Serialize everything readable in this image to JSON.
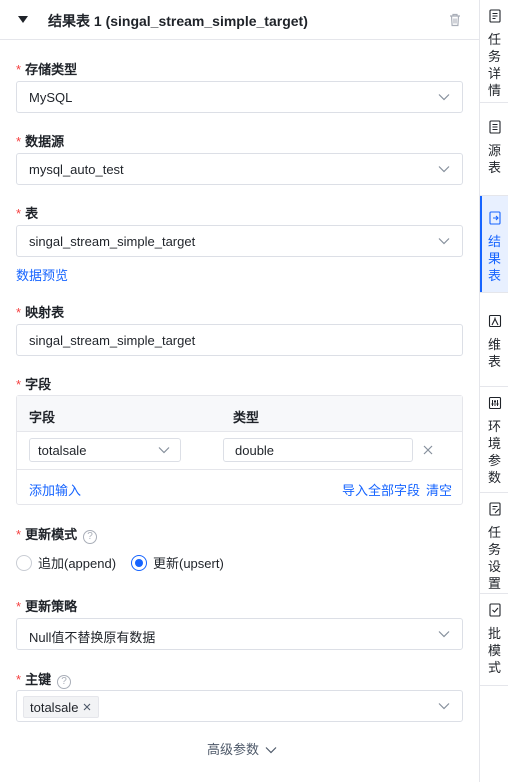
{
  "header": {
    "title": "结果表 1 (singal_stream_simple_target)"
  },
  "form": {
    "storage_type": {
      "label": "存储类型",
      "value": "MySQL"
    },
    "datasource": {
      "label": "数据源",
      "value": "mysql_auto_test"
    },
    "table": {
      "label": "表",
      "value": "singal_stream_simple_target",
      "preview_link": "数据预览"
    },
    "mapping_table": {
      "label": "映射表",
      "value": "singal_stream_simple_target"
    },
    "fields": {
      "label": "字段",
      "col_field": "字段",
      "col_type": "类型",
      "rows": [
        {
          "field": "totalsale",
          "type": "double"
        }
      ],
      "add_input": "添加输入",
      "import_all": "导入全部字段",
      "clear": "清空"
    },
    "update_mode": {
      "label": "更新模式",
      "help": "?",
      "options": [
        {
          "label": "追加(append)",
          "selected": false
        },
        {
          "label": "更新(upsert)",
          "selected": true
        }
      ]
    },
    "update_strategy": {
      "label": "更新策略",
      "value": "Null值不替换原有数据"
    },
    "primary_key": {
      "label": "主键",
      "help": "?",
      "tags": [
        "totalsale"
      ]
    },
    "advanced": "高级参数"
  },
  "sidebar": {
    "items": [
      {
        "label": "任务详情",
        "icon": "document-list-icon",
        "active": false
      },
      {
        "label": "源表",
        "icon": "source-table-icon",
        "active": false
      },
      {
        "label": "结果表",
        "icon": "result-table-icon",
        "active": true
      },
      {
        "label": "维表",
        "icon": "dimension-table-icon",
        "active": false
      },
      {
        "label": "环境参数",
        "icon": "sliders-icon",
        "active": false
      },
      {
        "label": "任务设置",
        "icon": "edit-doc-icon",
        "active": false
      },
      {
        "label": "批模式",
        "icon": "batch-check-icon",
        "active": false
      }
    ]
  },
  "colors": {
    "accent": "#1664ff",
    "required": "#f53f3f",
    "border": "#dcdfe6"
  }
}
